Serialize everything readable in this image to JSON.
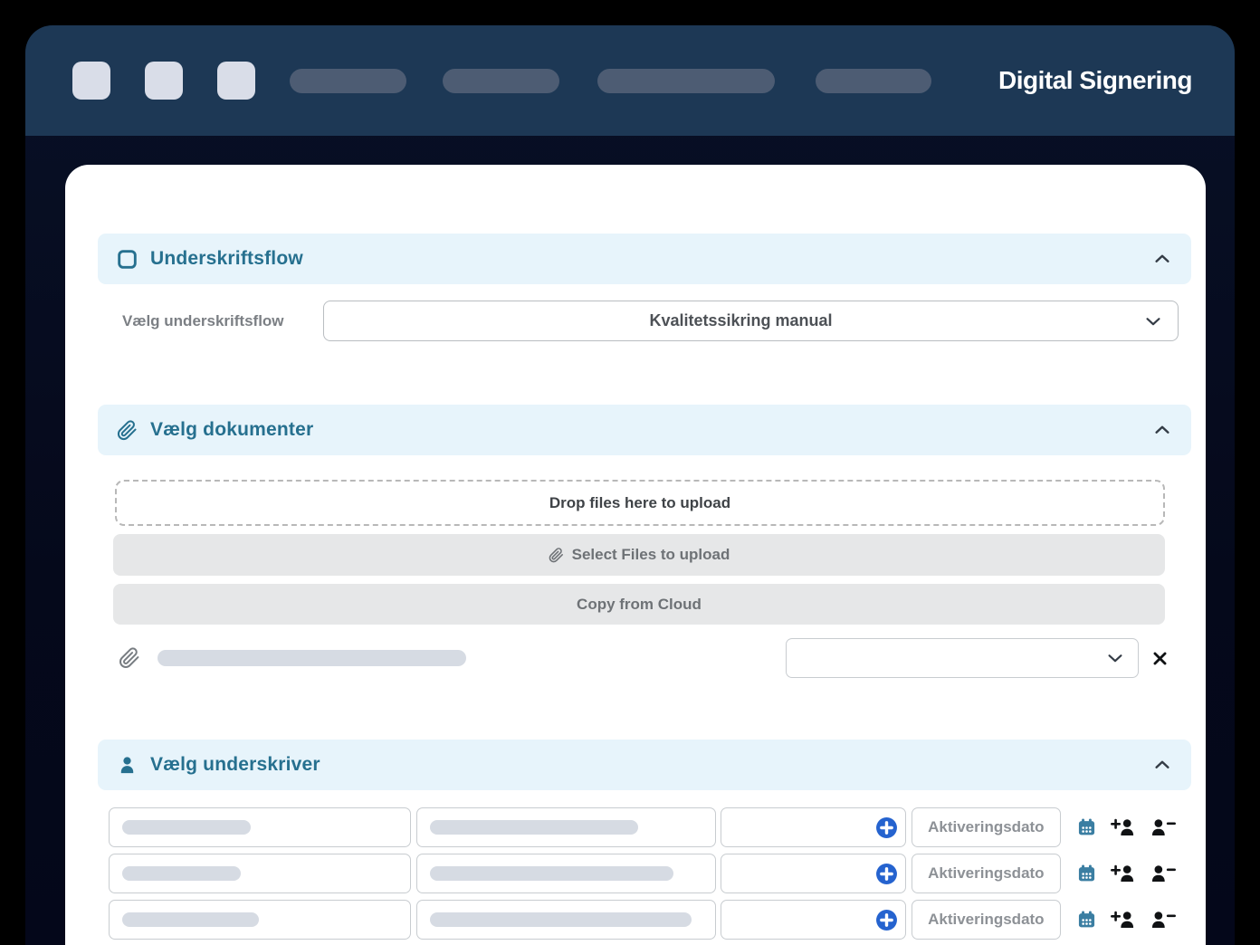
{
  "header": {
    "title": "Digital Signering"
  },
  "sections": {
    "flow": {
      "title": "Underskriftsflow",
      "select_label": "Vælg underskriftsflow",
      "selected_option": "Kvalitetssikring manual"
    },
    "documents": {
      "title": "Vælg dokumenter",
      "dropzone_text": "Drop files here to upload",
      "select_files_label": "Select Files to upload",
      "copy_cloud_label": "Copy from Cloud"
    },
    "signers": {
      "title": "Vælg underskriver",
      "activation_date_label": "Aktiveringsdato",
      "row_count": 3
    }
  },
  "icons": {
    "flow_section": "checkbox-outline",
    "documents_section": "paperclip",
    "signers_section": "person",
    "collapse": "chevron-up",
    "dropdown": "chevron-down",
    "file_remove": "x-cross",
    "signer_add": "plus-circle",
    "signer_calendar": "calendar",
    "signer_add_person": "person-plus",
    "signer_remove_person": "person-minus"
  },
  "colors": {
    "accent_teal": "#26708f",
    "section_header_bg": "#e7f4fb",
    "frame_header_bg": "#1d3855",
    "plus_blue": "#2563cf",
    "calendar_teal": "#3b7ea2",
    "placeholder_gray": "#d6dbe3"
  }
}
